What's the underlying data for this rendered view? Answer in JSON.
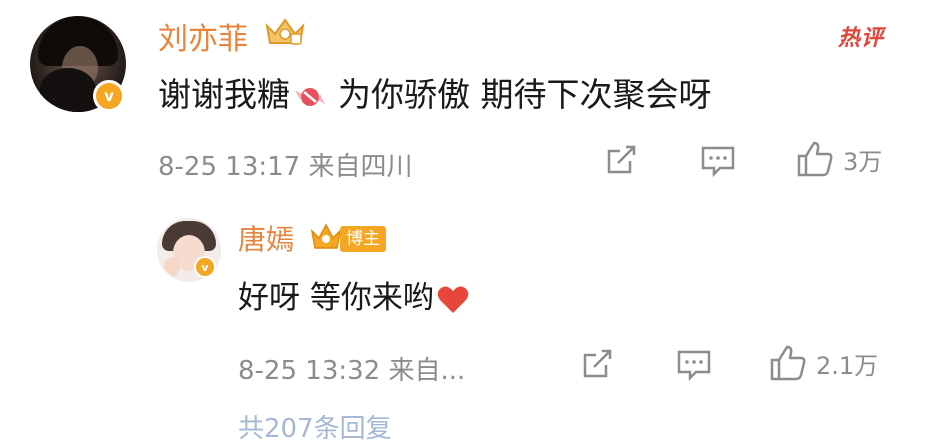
{
  "comment": {
    "author": "刘亦菲",
    "hot_tag": "热评",
    "text": "谢谢我糖",
    "text_after_icon": "为你骄傲 期待下次聚会呀",
    "time": "8-25 13:17",
    "source": "来自四川",
    "like_count": "3万",
    "verified_mark": "v"
  },
  "reply": {
    "author": "唐嫣",
    "author_badge": "博主",
    "text": "好呀 等你来哟",
    "time": "8-25 13:32",
    "source": "来自...",
    "like_count": "2.1万",
    "verified_mark": "v"
  },
  "footer": {
    "more_replies": "共207条回复"
  },
  "colors": {
    "name": "#e8843b",
    "badge": "#f5a623",
    "hot": "#e0463a",
    "meta": "#8c8c8c",
    "link": "#5b7fb0"
  },
  "icons": [
    "share-icon",
    "comment-icon",
    "like-icon",
    "candy-icon",
    "heart-icon",
    "crown-icon",
    "verified-icon"
  ]
}
